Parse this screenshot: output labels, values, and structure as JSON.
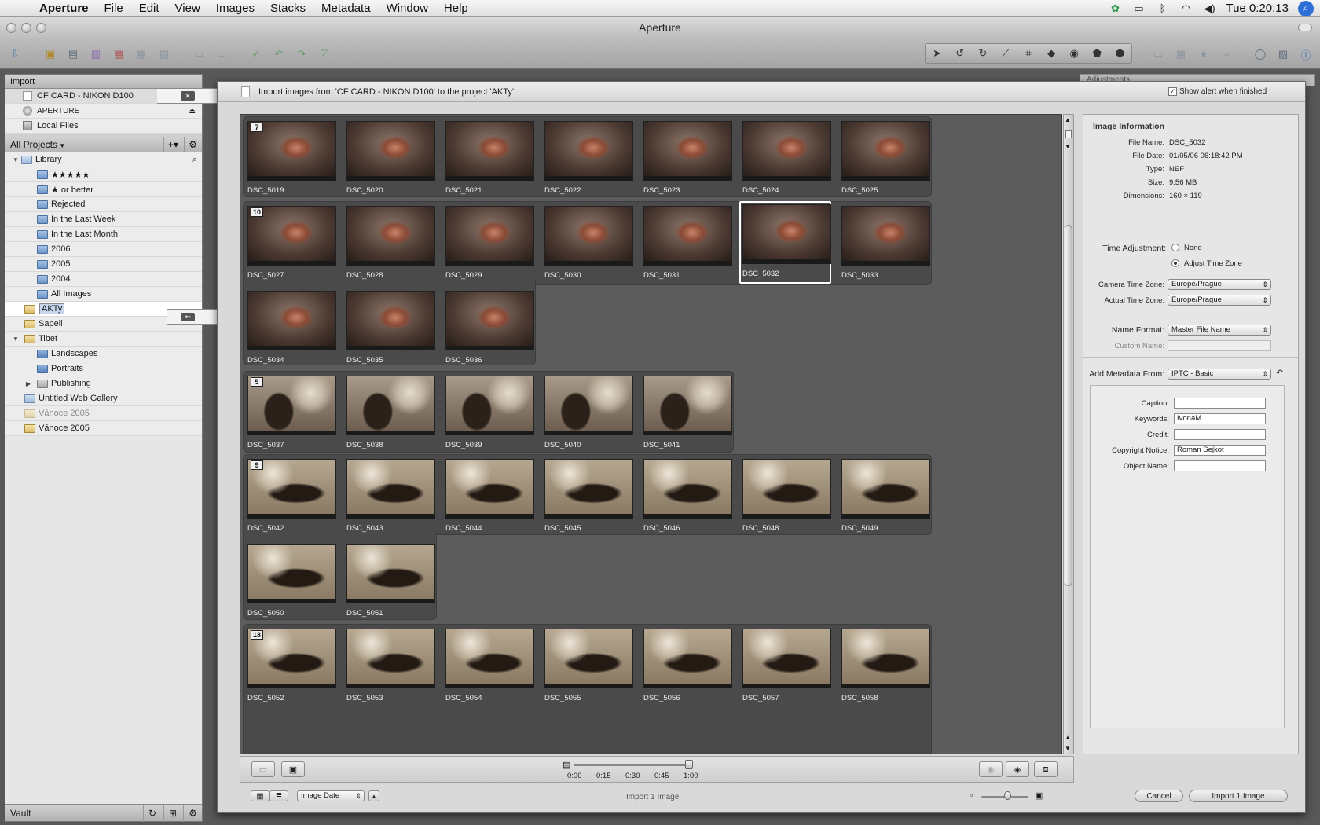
{
  "menubar": {
    "app": "Aperture",
    "items": [
      "File",
      "Edit",
      "View",
      "Images",
      "Stacks",
      "Metadata",
      "Window",
      "Help"
    ],
    "clock": "Tue 0:20:13"
  },
  "window": {
    "title": "Aperture"
  },
  "left_panel": {
    "import_header": "Import",
    "sources": [
      "CF  CARD - NIKON D100",
      "APERTURE",
      "Local Files"
    ],
    "projects_header": "All Projects",
    "tree": {
      "library": "Library",
      "library_items": [
        "★★★★★",
        "★ or better",
        "Rejected",
        "In the Last Week",
        "In the Last Month",
        "2006",
        "2005",
        "2004",
        "All Images"
      ],
      "aktY": "AKTy",
      "sapeli": "Sapeli",
      "tibet": "Tibet",
      "tibet_items": [
        "Landscapes",
        "Portraits",
        "Publishing"
      ],
      "web_gallery": "Untitled Web Gallery",
      "vanoce_dim": "Vánoce 2005",
      "vanoce": "Vánoce 2005"
    },
    "vault": "Vault"
  },
  "sheet": {
    "title": "Import images from 'CF  CARD - NIKON D100' to the project 'AKTy'",
    "show_alert": "Show alert when finished",
    "stacks": [
      {
        "badge": "7",
        "images": [
          "DSC_5019",
          "DSC_5020",
          "DSC_5021",
          "DSC_5022",
          "DSC_5023",
          "DSC_5024",
          "DSC_5025"
        ]
      },
      {
        "badge": "10",
        "images": [
          "DSC_5027",
          "DSC_5028",
          "DSC_5029",
          "DSC_5030",
          "DSC_5031",
          "DSC_5032",
          "DSC_5033",
          "DSC_5034",
          "DSC_5035",
          "DSC_5036"
        ]
      },
      {
        "badge": "5",
        "images": [
          "DSC_5037",
          "DSC_5038",
          "DSC_5039",
          "DSC_5040",
          "DSC_5041"
        ]
      },
      {
        "badge": "9",
        "images": [
          "DSC_5042",
          "DSC_5043",
          "DSC_5044",
          "DSC_5045",
          "DSC_5046",
          "DSC_5048",
          "DSC_5049",
          "DSC_5050",
          "DSC_5051"
        ]
      },
      {
        "badge": "18",
        "images": [
          "DSC_5052",
          "DSC_5053",
          "DSC_5054",
          "DSC_5055",
          "DSC_5056",
          "DSC_5057",
          "DSC_5058"
        ]
      }
    ],
    "selected_image": "DSC_5032",
    "time_ticks": [
      "0:00",
      "0:15",
      "0:30",
      "0:45",
      "1:00"
    ],
    "sort": "Image Date",
    "status": "Import 1 Image",
    "cancel": "Cancel",
    "import_button": "Import 1 Image"
  },
  "info": {
    "header": "Image Information",
    "file_name_label": "File Name:",
    "file_name": "DSC_5032",
    "file_date_label": "File Date:",
    "file_date": "01/05/06  06:18:42 PM",
    "type_label": "Type:",
    "type": "NEF",
    "size_label": "Size:",
    "size": "9.56 MB",
    "dimensions_label": "Dimensions:",
    "dimensions": "160 × 119",
    "time_adj_label": "Time Adjustment:",
    "opt_none": "None",
    "opt_adjust": "Adjust Time Zone",
    "camera_tz_label": "Camera Time Zone:",
    "camera_tz": "Europe/Prague",
    "actual_tz_label": "Actual Time Zone:",
    "actual_tz": "Europe/Prague",
    "name_format_label": "Name Format:",
    "name_format": "Master File Name",
    "custom_name_label": "Custom Name:",
    "add_meta_label": "Add Metadata From:",
    "add_meta": "IPTC - Basic",
    "caption_label": "Caption:",
    "keywords_label": "Keywords:",
    "keywords": "IvonaM",
    "credit_label": "Credit:",
    "copyright_label": "Copyright Notice:",
    "copyright": "Roman Sejkot",
    "object_label": "Object Name:"
  },
  "behind": {
    "adjustments": "Adjustments"
  }
}
